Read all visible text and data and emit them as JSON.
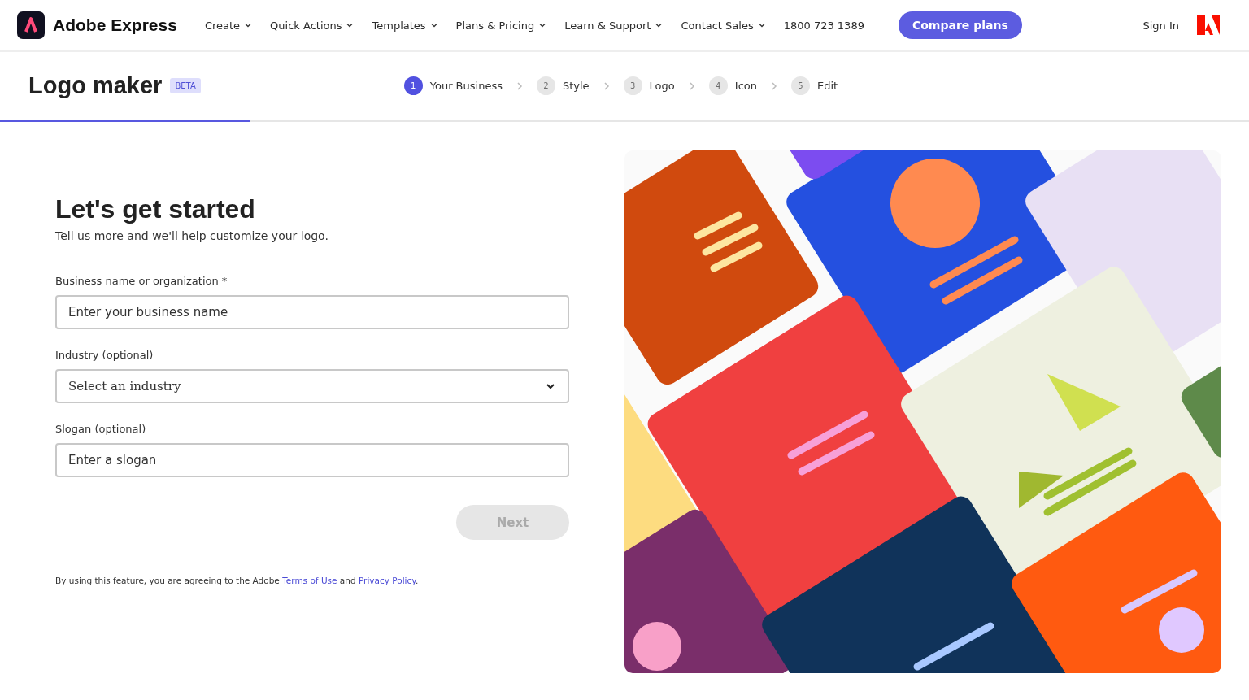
{
  "header": {
    "brand": "Adobe Express",
    "nav": [
      {
        "label": "Create",
        "has_menu": true
      },
      {
        "label": "Quick Actions",
        "has_menu": true
      },
      {
        "label": "Templates",
        "has_menu": true
      },
      {
        "label": "Plans & Pricing",
        "has_menu": true
      },
      {
        "label": "Learn & Support",
        "has_menu": true
      },
      {
        "label": "Contact Sales",
        "has_menu": true
      },
      {
        "label": "1800 723 1389",
        "has_menu": false
      }
    ],
    "cta": "Compare plans",
    "sign_in": "Sign In"
  },
  "title_bar": {
    "title": "Logo maker",
    "badge": "BETA",
    "steps": [
      {
        "number": "1",
        "label": "Your Business",
        "selected": true
      },
      {
        "number": "2",
        "label": "Style",
        "selected": false
      },
      {
        "number": "3",
        "label": "Logo",
        "selected": false
      },
      {
        "number": "4",
        "label": "Icon",
        "selected": false
      },
      {
        "number": "5",
        "label": "Edit",
        "selected": false
      }
    ],
    "progress": {
      "level": 0.2
    }
  },
  "form": {
    "heading": "Let's get started",
    "subheading": "Tell us more and we'll help customize your logo.",
    "fields": [
      {
        "kind": "text",
        "label": "Business name or organization *",
        "placeholder": "Enter your business name"
      },
      {
        "kind": "select",
        "label": "Industry (optional)",
        "placeholder": "Select an industry"
      },
      {
        "kind": "text",
        "label": "Slogan (optional)",
        "placeholder": "Enter a slogan"
      }
    ],
    "next": {
      "label": "Next",
      "disabled": true
    },
    "legal": [
      {
        "kind": "text",
        "text": "By using this feature, you are agreeing to the Adobe "
      },
      {
        "kind": "link",
        "text": "Terms of Use"
      },
      {
        "kind": "text",
        "text": " and "
      },
      {
        "kind": "link",
        "text": "Privacy Policy"
      },
      {
        "kind": "text",
        "text": "."
      }
    ]
  }
}
